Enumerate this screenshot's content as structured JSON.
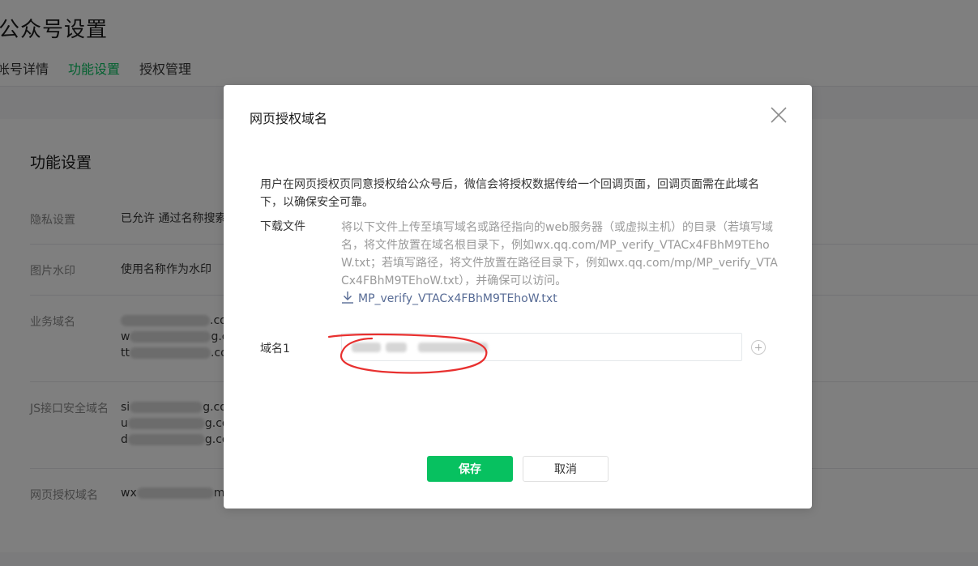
{
  "page": {
    "title": "公众号设置",
    "tabs": [
      {
        "label": "帐号详情",
        "active": false
      },
      {
        "label": "功能设置",
        "active": true
      },
      {
        "label": "授权管理",
        "active": false
      }
    ],
    "section_title": "功能设置",
    "rows": [
      {
        "label": "隐私设置",
        "value": "已允许 通过名称搜索"
      },
      {
        "label": "图片水印",
        "value": "使用名称作为水印"
      },
      {
        "label": "业务域名",
        "lines": [
          {
            "prefix": "",
            "suffix": ".co"
          },
          {
            "prefix": "w",
            "suffix": "g.c"
          },
          {
            "prefix": "tt",
            "suffix": ".co"
          }
        ]
      },
      {
        "label": "JS接口安全域名",
        "lines": [
          {
            "prefix": "si",
            "suffix": "g.co"
          },
          {
            "prefix": "u",
            "suffix": "g.co"
          },
          {
            "prefix": "d",
            "suffix": "g.co"
          }
        ]
      },
      {
        "label": "网页授权域名",
        "value_prefix": "wx",
        "value_suffix": "mo"
      }
    ]
  },
  "dialog": {
    "title": "网页授权域名",
    "description": "用户在网页授权页同意授权给公众号后，微信会将授权数据传给一个回调页面，回调页面需在此域名下，以确保安全可靠。",
    "download": {
      "label": "下载文件",
      "instructions": "将以下文件上传至填写域名或路径指向的web服务器（或虚拟主机）的目录（若填写域名，将文件放置在域名根目录下，例如wx.qq.com/MP_verify_VTACx4FBhM9TEhoW.txt；若填写路径，将文件放置在路径目录下，例如wx.qq.com/mp/MP_verify_VTACx4FBhM9TEhoW.txt），并确保可以访问。",
      "filename": "MP_verify_VTACx4FBhM9TEhoW.txt"
    },
    "domain": {
      "label": "域名1",
      "value": ""
    },
    "buttons": {
      "save": "保存",
      "cancel": "取消"
    }
  },
  "colors": {
    "accent": "#07c160",
    "link": "#576b95",
    "annotation": "#e8302f",
    "overlay": "rgba(0,0,0,0.5)"
  },
  "icons": {
    "close": "close-icon",
    "download": "download-icon",
    "add": "plus-circle-icon"
  }
}
